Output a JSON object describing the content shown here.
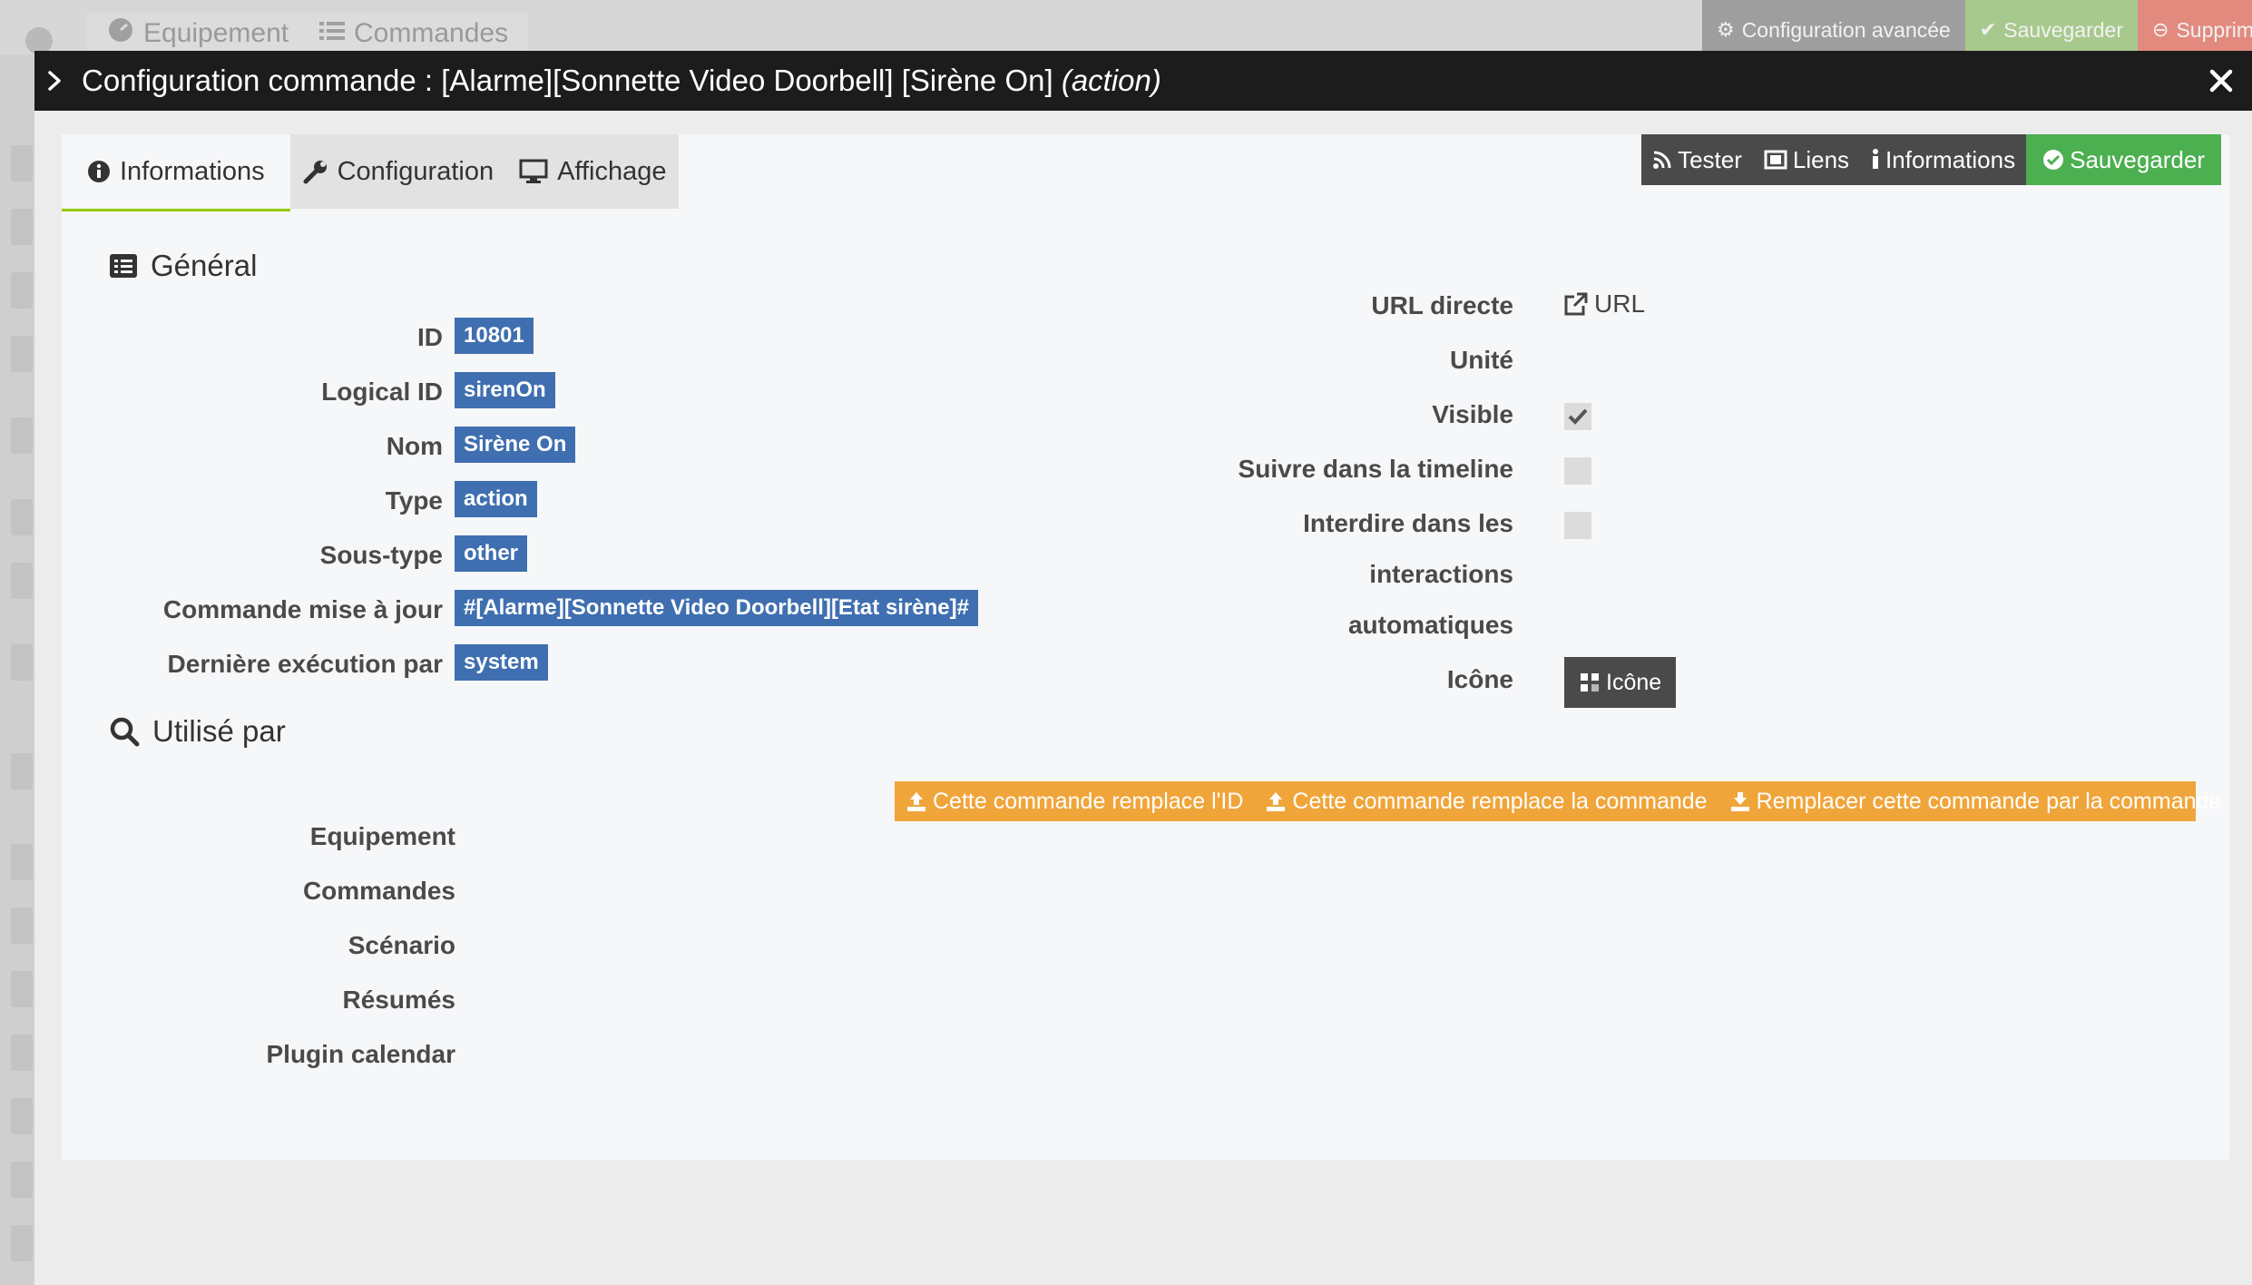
{
  "background": {
    "tabs": [
      {
        "label": "Equipement",
        "icon": "tachometer-icon"
      },
      {
        "label": "Commandes",
        "icon": "list-icon"
      }
    ],
    "actions": [
      {
        "label": "Configuration avancée",
        "icon": "cogs-icon",
        "color": "#9e9e9e"
      },
      {
        "label": "Sauvegarder",
        "icon": "check-circle-icon",
        "color": "#a8c98e"
      },
      {
        "label": "Supprimer",
        "icon": "minus-circle-icon",
        "color": "#e38a7f"
      }
    ]
  },
  "modal": {
    "title_prefix": "Configuration commande : [Alarme][Sonnette Video Doorbell] [Sirène On]",
    "title_suffix": "(action)"
  },
  "tabs": [
    {
      "label": "Informations",
      "icon": "info-circle-icon",
      "active": true
    },
    {
      "label": "Configuration",
      "icon": "wrench-icon",
      "active": false
    },
    {
      "label": "Affichage",
      "icon": "desktop-icon",
      "active": false
    }
  ],
  "toolbar": {
    "test": "Tester",
    "links": "Liens",
    "informations": "Informations",
    "save": "Sauvegarder"
  },
  "general": {
    "title": "Général",
    "fields": {
      "id": {
        "label": "ID",
        "value": "10801"
      },
      "logical_id": {
        "label": "Logical ID",
        "value": "sirenOn"
      },
      "name": {
        "label": "Nom",
        "value": "Sirène On"
      },
      "type": {
        "label": "Type",
        "value": "action"
      },
      "subtype": {
        "label": "Sous-type",
        "value": "other"
      },
      "update_cmd": {
        "label": "Commande mise à jour",
        "value": "#[Alarme][Sonnette Video Doorbell][Etat sirène]#"
      },
      "last_exec": {
        "label": "Dernière exécution par",
        "value": "system"
      }
    },
    "right": {
      "url_label": "URL directe",
      "url_link": "URL",
      "unit_label": "Unité",
      "visible_label": "Visible",
      "visible_checked": true,
      "timeline_label": "Suivre dans la timeline",
      "timeline_checked": false,
      "interdire_line1": "Interdire dans les",
      "interdire_line2": "interactions",
      "interdire_line3": "automatiques",
      "interdire_checked": false,
      "icon_label": "Icône",
      "icon_button": "Icône"
    }
  },
  "used_by": {
    "title": "Utilisé par",
    "rows": [
      "Equipement",
      "Commandes",
      "Scénario",
      "Résumés",
      "Plugin calendar"
    ],
    "actions": [
      {
        "label": "Cette commande remplace l'ID",
        "icon": "upload-icon"
      },
      {
        "label": "Cette commande remplace la commande",
        "icon": "upload-icon"
      },
      {
        "label": "Remplacer cette commande par la commande",
        "icon": "download-icon"
      }
    ]
  }
}
